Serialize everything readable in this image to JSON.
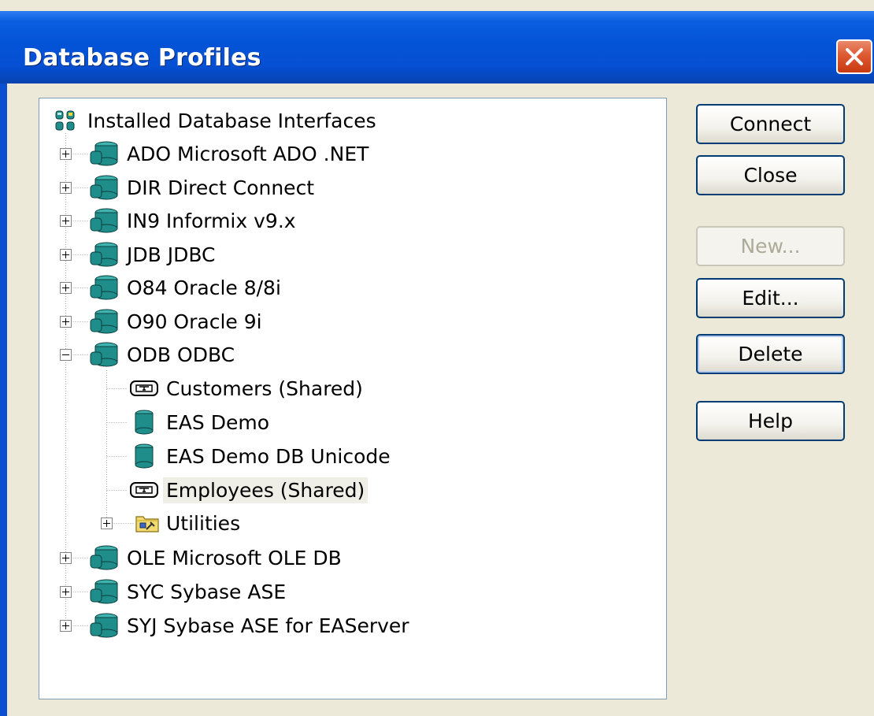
{
  "window": {
    "title": "Database Profiles",
    "close_icon": "close-icon"
  },
  "tree": {
    "root": {
      "label": "Installed Database Interfaces",
      "icon": "database-interfaces-icon"
    },
    "interfaces": [
      {
        "label": "ADO Microsoft ADO .NET",
        "expanded": false,
        "icon": "database-icon"
      },
      {
        "label": "DIR Direct Connect",
        "expanded": false,
        "icon": "database-icon"
      },
      {
        "label": "IN9 Informix v9.x",
        "expanded": false,
        "icon": "database-icon"
      },
      {
        "label": "JDB JDBC",
        "expanded": false,
        "icon": "database-icon"
      },
      {
        "label": "O84 Oracle 8/8i",
        "expanded": false,
        "icon": "database-icon"
      },
      {
        "label": "O90 Oracle 9i",
        "expanded": false,
        "icon": "database-icon"
      },
      {
        "label": "ODB ODBC",
        "expanded": true,
        "icon": "database-icon"
      },
      {
        "label": "OLE Microsoft OLE DB",
        "expanded": false,
        "icon": "database-icon"
      },
      {
        "label": "SYC Sybase ASE",
        "expanded": false,
        "icon": "database-icon"
      },
      {
        "label": "SYJ Sybase ASE for EAServer",
        "expanded": false,
        "icon": "database-icon"
      }
    ],
    "odbc_children": [
      {
        "label": "Customers (Shared)",
        "icon": "shared-profile-icon"
      },
      {
        "label": "EAS Demo",
        "icon": "database-profile-icon"
      },
      {
        "label": "EAS Demo DB Unicode",
        "icon": "database-profile-icon"
      },
      {
        "label": "Employees (Shared)",
        "icon": "shared-profile-icon",
        "selected": true
      },
      {
        "label": "Utilities",
        "icon": "utilities-folder-icon",
        "expanded": false
      }
    ]
  },
  "buttons": {
    "connect": {
      "label": "Connect",
      "enabled": true
    },
    "close": {
      "label": "Close",
      "enabled": true
    },
    "new": {
      "label": "New...",
      "enabled": false
    },
    "edit": {
      "label": "Edit...",
      "enabled": true
    },
    "delete": {
      "label": "Delete",
      "enabled": true
    },
    "help": {
      "label": "Help",
      "enabled": true
    }
  },
  "colors": {
    "titlebar": "#0453d6",
    "dialog_background": "#ece9d8",
    "db_icon": "#1f8d8a",
    "button_border": "#003c74"
  }
}
